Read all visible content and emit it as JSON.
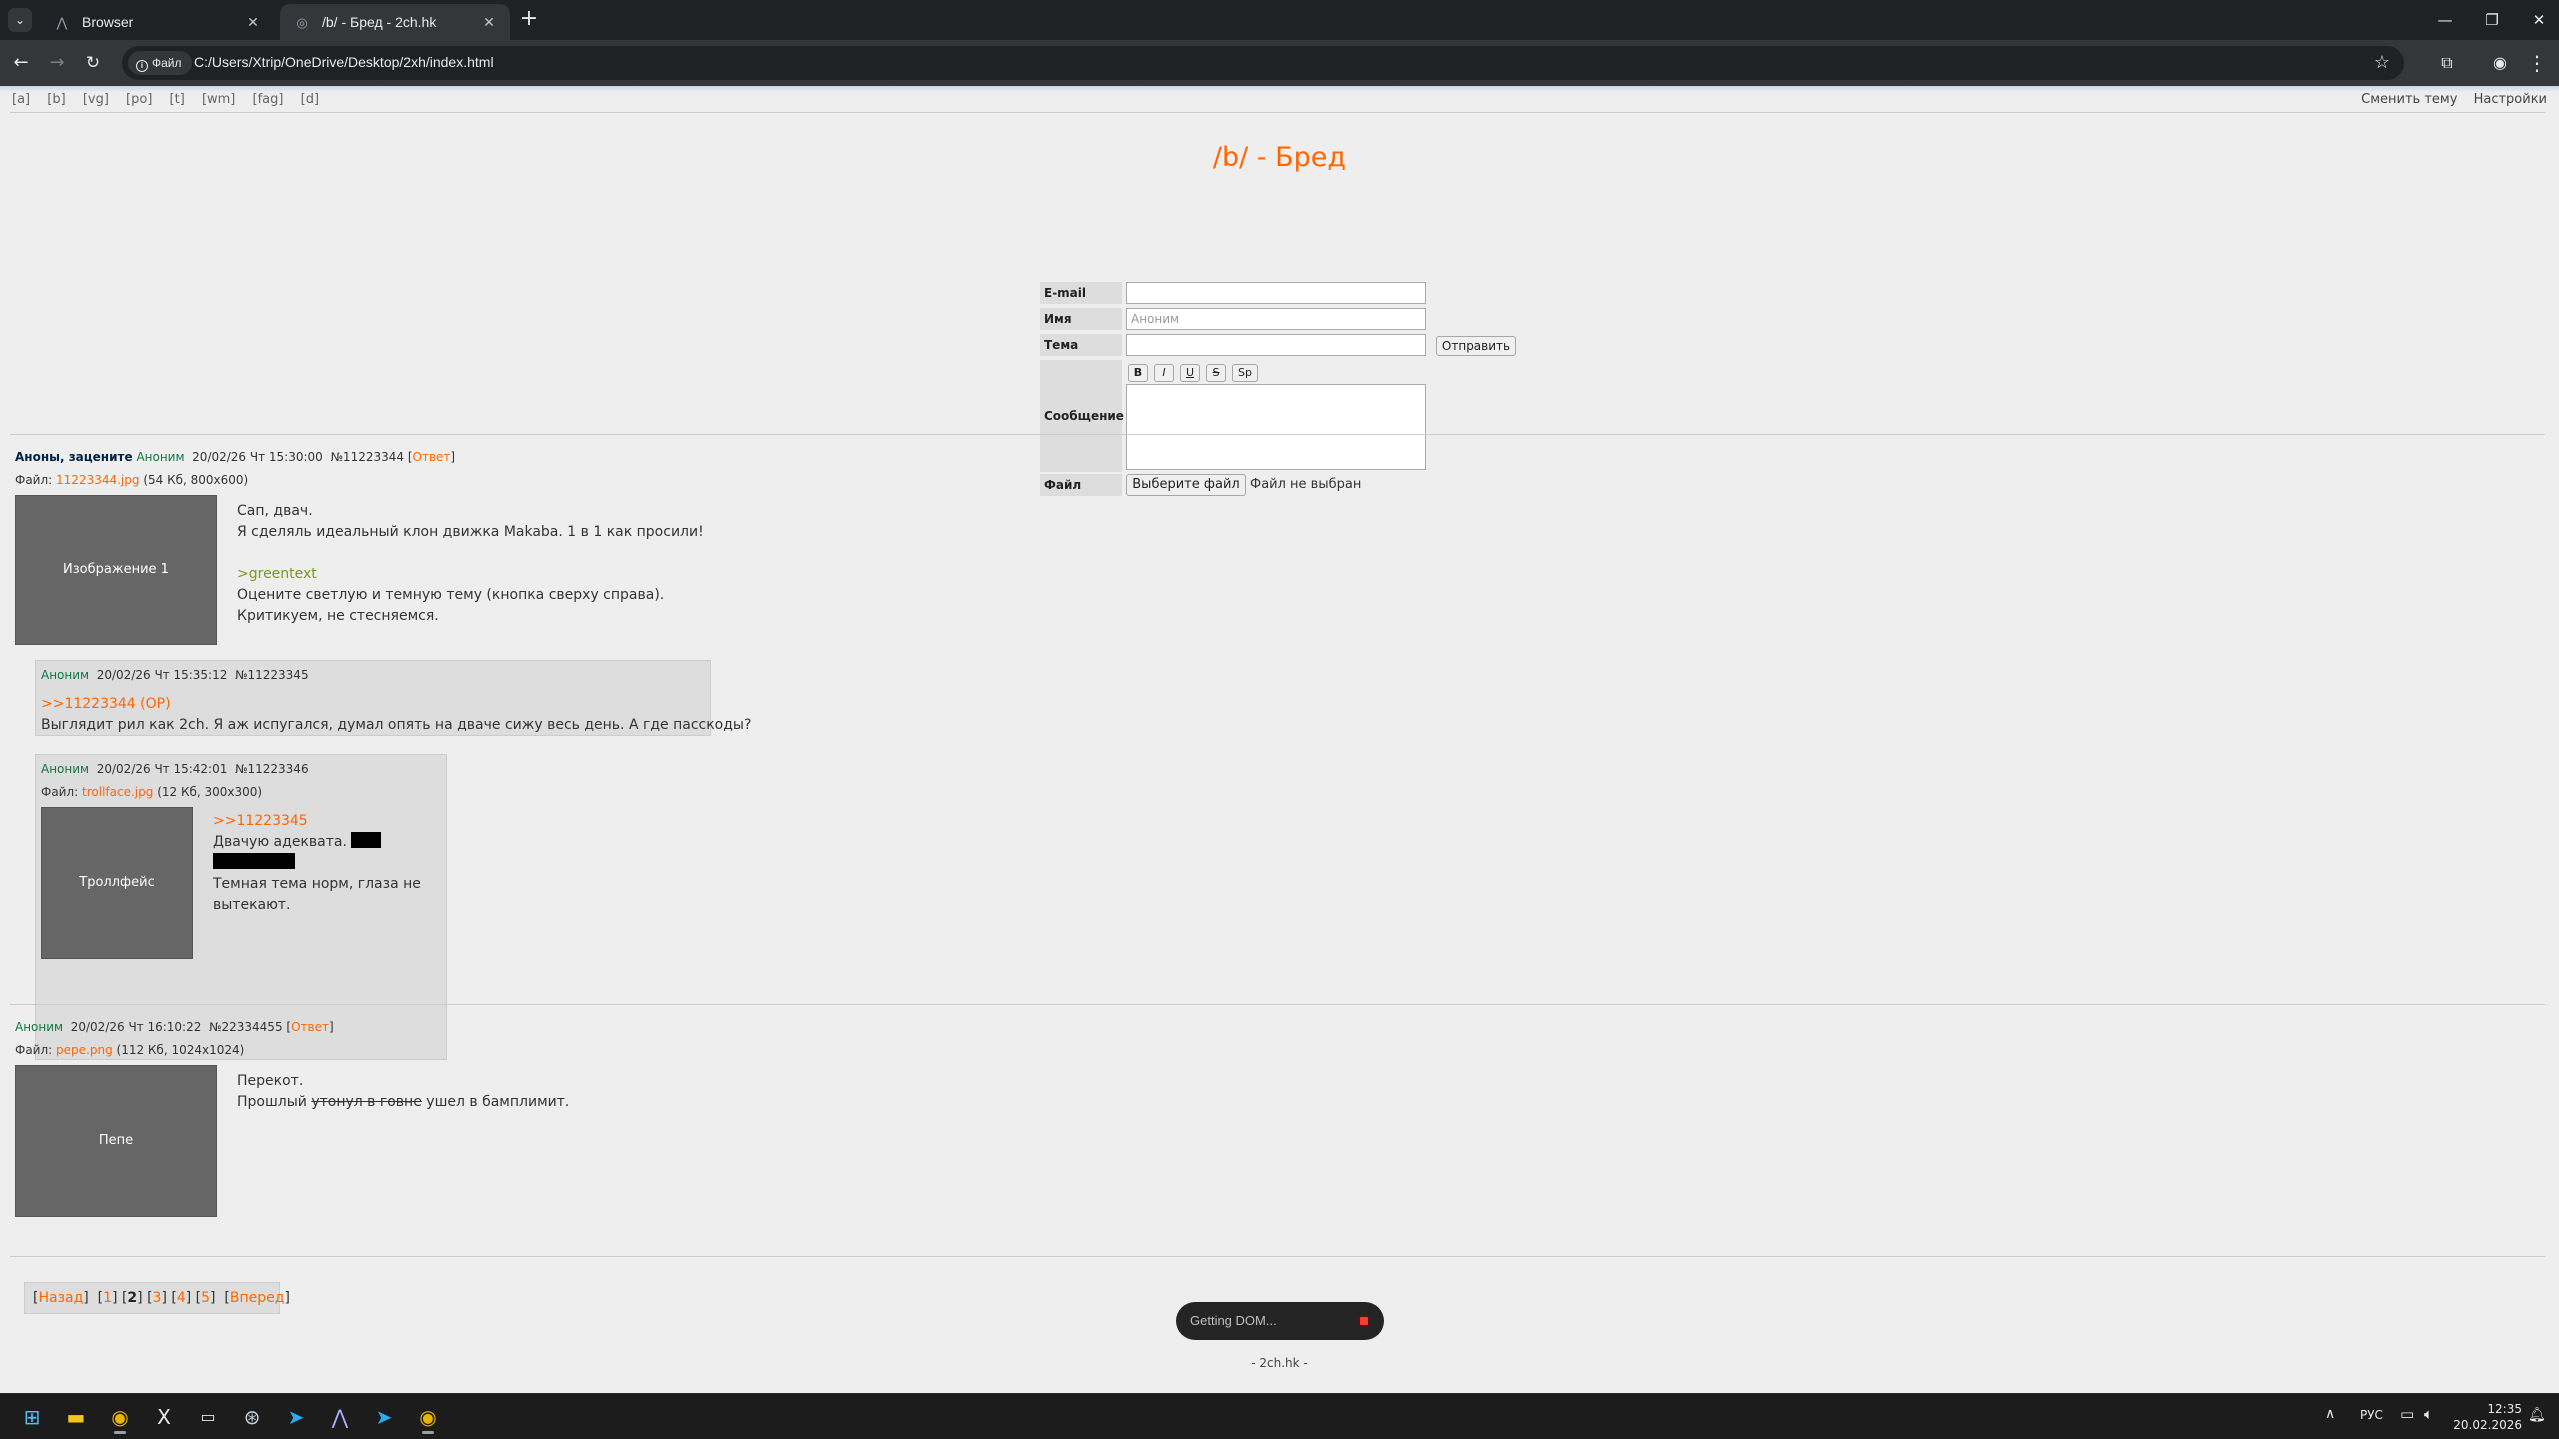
{
  "browser": {
    "tabs": [
      {
        "title": "Browser",
        "icon": "ai-browser-icon"
      },
      {
        "title": "/b/ - Бред - 2ch.hk",
        "icon": "globe-icon"
      }
    ],
    "site_chip": "Файл",
    "url": "C:/Users/Xtrip/OneDrive/Desktop/2xh/index.html"
  },
  "page": {
    "boards": [
      "[a]",
      "[b]",
      "[vg]",
      "[po]",
      "[t]",
      "[wm]",
      "[fag]",
      "[d]"
    ],
    "top_right": {
      "theme": "Сменить тему",
      "settings": "Настройки"
    },
    "board_title": "/b/ - Бред",
    "form": {
      "email_label": "E-mail",
      "name_label": "Имя",
      "name_placeholder": "Аноним",
      "subject_label": "Тема",
      "submit": "Отправить",
      "message_label": "Сообщение",
      "format_buttons": [
        "B",
        "I",
        "U",
        "S",
        "Sp"
      ],
      "file_label": "Файл",
      "file_button": "Выберите файл",
      "file_status": "Файл не выбран"
    },
    "threads": [
      {
        "op": {
          "subject": "Аноны, зацените",
          "name": "Аноним",
          "date": "20/02/26 Чт 15:30:00",
          "num": "№11223344",
          "reply_open": "[",
          "reply": "Ответ",
          "reply_close": "]",
          "file_prefix": "Файл:",
          "file_name": "11223344.jpg",
          "file_meta": "(54 Кб, 800x600)",
          "thumb": "Изображение 1",
          "lines": [
            "Сап, двач.",
            "Я сделяль идеальный клон движка Makaba. 1 в 1 как просили!",
            ">greentext",
            "Оцените светлую и темную тему (кнопка сверху справа).",
            "Критикуем, не стесняемся."
          ]
        },
        "replies": [
          {
            "name": "Аноним",
            "date": "20/02/26 Чт 15:35:12",
            "num": "№11223345",
            "link": ">>11223344 (OP)",
            "text": "Выглядит рил как 2ch. Я аж испугался, думал опять на дваче сижу весь день. А где пасскоды?"
          },
          {
            "name": "Аноним",
            "date": "20/02/26 Чт 15:42:01",
            "num": "№11223346",
            "file_prefix": "Файл:",
            "file_name": "trollface.jpg",
            "file_meta": "(12 Кб, 300x300)",
            "thumb": "Троллфейс",
            "link": ">>11223345",
            "line1": "Двачую адеквата.",
            "line3a": "Темная тема норм, глаза не",
            "line3b": "вытекают."
          }
        ]
      },
      {
        "op": {
          "name": "Аноним",
          "date": "20/02/26 Чт 16:10:22",
          "num": "№22334455",
          "reply_open": "[",
          "reply": "Ответ",
          "reply_close": "]",
          "file_prefix": "Файл:",
          "file_name": "pepe.png",
          "file_meta": "(112 Кб, 1024x1024)",
          "thumb": "Пепе",
          "line1": "Перекот.",
          "line2_a": "Прошлый",
          "line2_strike": "утонул в говне",
          "line2_b": "ушел в бамплимит."
        }
      }
    ],
    "pager": {
      "prev": "Назад",
      "pages": [
        "1",
        "2",
        "3",
        "4",
        "5"
      ],
      "current": "2",
      "next": "Вперед"
    },
    "footer": "- 2ch.hk -",
    "status_pill": "Getting DOM..."
  },
  "taskbar": {
    "apps": [
      "windows-start-icon",
      "file-explorer-icon",
      "chrome-icon",
      "x-icon",
      "terminal-icon",
      "steam-icon",
      "telegram-icon",
      "ai-browser-icon",
      "telegram-icon",
      "chrome-icon"
    ],
    "lang": "РУС",
    "time": "12:35",
    "date": "20.02.2026"
  }
}
